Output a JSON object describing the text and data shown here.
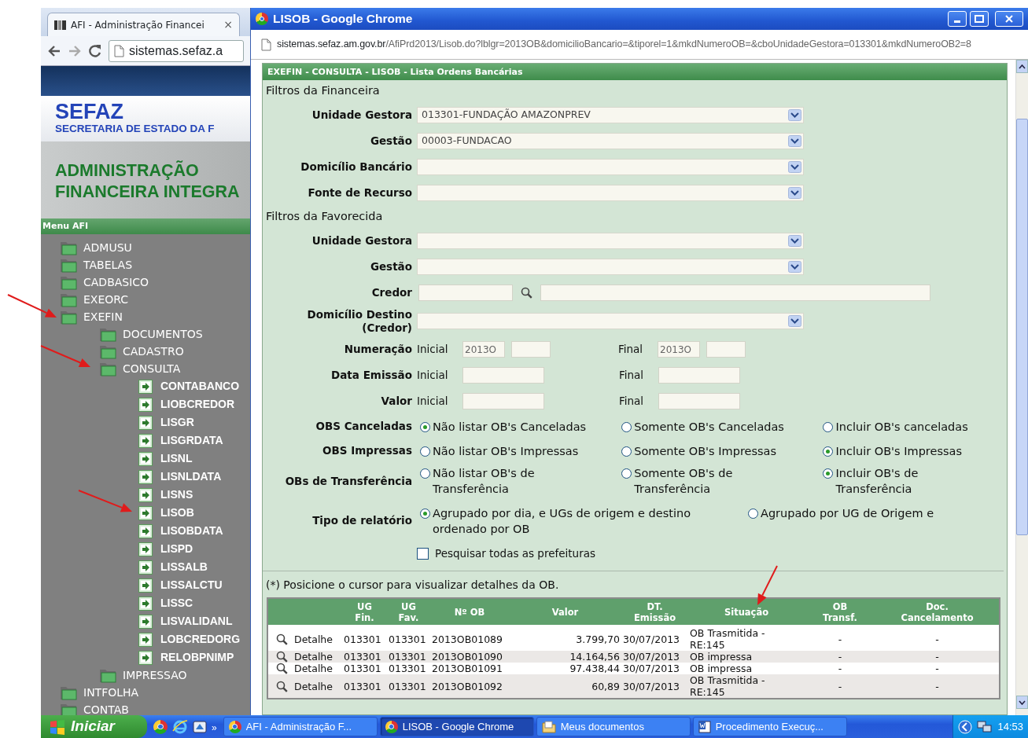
{
  "background_window": {
    "tab": {
      "title": "AFI - Administração Financei",
      "close": "×"
    },
    "address": "sistemas.sefaz.a",
    "header": {
      "brand": "SEFAZ",
      "subtitle": "SECRETARIA DE ESTADO DA F",
      "banner": [
        "ADMINISTRAÇÃO",
        "FINANCEIRA INTEGRA"
      ]
    },
    "menu": {
      "title": "Menu AFI",
      "items": [
        {
          "label": "ADMUSU",
          "kind": "folder"
        },
        {
          "label": "TABELAS",
          "kind": "folder"
        },
        {
          "label": "CADBASICO",
          "kind": "folder"
        },
        {
          "label": "EXEORC",
          "kind": "folder"
        },
        {
          "label": "EXEFIN",
          "kind": "folder",
          "children": [
            {
              "label": "DOCUMENTOS",
              "kind": "folder"
            },
            {
              "label": "CADASTRO",
              "kind": "folder"
            },
            {
              "label": "CONSULTA",
              "kind": "folder",
              "children": [
                {
                  "label": "CONTABANCO",
                  "kind": "page"
                },
                {
                  "label": "LIOBCREDOR",
                  "kind": "page"
                },
                {
                  "label": "LISGR",
                  "kind": "page"
                },
                {
                  "label": "LISGRDATA",
                  "kind": "page"
                },
                {
                  "label": "LISNL",
                  "kind": "page"
                },
                {
                  "label": "LISNLDATA",
                  "kind": "page"
                },
                {
                  "label": "LISNS",
                  "kind": "page"
                },
                {
                  "label": "LISOB",
                  "kind": "page"
                },
                {
                  "label": "LISOBDATA",
                  "kind": "page"
                },
                {
                  "label": "LISPD",
                  "kind": "page"
                },
                {
                  "label": "LISSALB",
                  "kind": "page"
                },
                {
                  "label": "LISSALCTU",
                  "kind": "page"
                },
                {
                  "label": "LISSC",
                  "kind": "page"
                },
                {
                  "label": "LISVALIDANL",
                  "kind": "page"
                },
                {
                  "label": "LOBCREDORG",
                  "kind": "page"
                },
                {
                  "label": "RELOBPNIMP",
                  "kind": "page"
                }
              ]
            },
            {
              "label": "IMPRESSAO",
              "kind": "folder"
            }
          ]
        },
        {
          "label": "INTFOLHA",
          "kind": "folder"
        },
        {
          "label": "CONTAB",
          "kind": "folder"
        }
      ]
    }
  },
  "popup_window": {
    "title": "LISOB - Google Chrome",
    "address": {
      "host": "sistemas.sefaz.am.gov.br",
      "path": "/AfiPrd2013/Lisob.do?lblgr=2013OB&domicilioBancario=&tiporel=1&mkdNumeroOB=&cboUnidadeGestora=013301&mkdNumeroOB2=8"
    },
    "panel_title": "EXEFIN - CONSULTA - LISOB - Lista Ordens Bancárias",
    "form": [
      {
        "kind": "section",
        "label": "Filtros da Financeira"
      },
      {
        "kind": "select",
        "label": "Unidade Gestora",
        "value": "013301-FUNDAÇÃO AMAZONPREV"
      },
      {
        "kind": "select",
        "label": "Gestão",
        "value": "00003-FUNDACAO"
      },
      {
        "kind": "select",
        "label": "Domicílio Bancário"
      },
      {
        "kind": "select",
        "label": "Fonte de Recurso"
      },
      {
        "kind": "section",
        "label": "Filtros da Favorecida"
      },
      {
        "kind": "select",
        "label": "Unidade Gestora"
      },
      {
        "kind": "select",
        "label": "Gestão"
      },
      {
        "kind": "lookup",
        "label": "Credor"
      },
      {
        "kind": "select",
        "label": "Domicílio Destino (Credor)"
      },
      {
        "kind": "range",
        "label": "Numeração",
        "from_label": "Inicial",
        "from_value": "2013O",
        "to_label": "Final",
        "to_value": "2013O"
      },
      {
        "kind": "range",
        "label": "Data Emissão",
        "from_label": "Inicial",
        "to_label": "Final"
      },
      {
        "kind": "range",
        "label": "Valor",
        "from_label": "Inicial",
        "to_label": "Final"
      },
      {
        "kind": "radio",
        "label": "OBS Canceladas",
        "options": [
          {
            "label": "Não listar OB's Canceladas",
            "selected": true
          },
          {
            "label": "Somente OB's Canceladas",
            "selected": false
          },
          {
            "label": "Incluir OB's canceladas",
            "selected": false
          }
        ]
      },
      {
        "kind": "radio",
        "label": "OBS Impressas",
        "options": [
          {
            "label": "Não listar OB's Impressas",
            "selected": false
          },
          {
            "label": "Somente OB's Impressas",
            "selected": false
          },
          {
            "label": "Incluir OB's Impressas",
            "selected": true
          }
        ]
      },
      {
        "kind": "radio",
        "label": "OBs de Transferência",
        "options": [
          {
            "label": "Não listar OB's de Transferência",
            "selected": false
          },
          {
            "label": "Somente OB's de Transferência",
            "selected": false
          },
          {
            "label": "Incluir OB's de Transferência",
            "selected": true
          }
        ]
      },
      {
        "kind": "radio",
        "label": "Tipo de relatório",
        "options": [
          {
            "label": "Agrupado por dia, e UGs de origem e destino ordenado por OB",
            "selected": true
          },
          {
            "label": "Agrupado por UG de Origem e",
            "selected": false
          }
        ]
      },
      {
        "kind": "checkbox",
        "label": "Pesquisar todas as prefeituras",
        "checked": false
      }
    ],
    "note": "(*) Posicione o cursor para visualizar detalhes da OB.",
    "table": {
      "columns": [
        "UG Fin.",
        "UG Fav.",
        "Nº OB",
        "Valor",
        "DT. Emissão",
        "Situação",
        "OB Transf.",
        "Doc. Cancelamento"
      ],
      "rows": [
        {
          "link": "Detalhe",
          "cells": [
            "013301",
            "013301",
            "2013OB01089",
            "3.799,70",
            "30/07/2013",
            "OB Trasmitida - RE:145",
            "-",
            "-"
          ]
        },
        {
          "link": "Detalhe",
          "cells": [
            "013301",
            "013301",
            "2013OB01090",
            "14.164,56",
            "30/07/2013",
            "OB impressa",
            "-",
            "-"
          ]
        },
        {
          "link": "Detalhe",
          "cells": [
            "013301",
            "013301",
            "2013OB01091",
            "97.438,44",
            "30/07/2013",
            "OB impressa",
            "-",
            "-"
          ]
        },
        {
          "link": "Detalhe",
          "cells": [
            "013301",
            "013301",
            "2013OB01092",
            "60,89",
            "30/07/2013",
            "OB Trasmitida - RE:145",
            "-",
            "-"
          ]
        }
      ]
    }
  },
  "taskbar": {
    "start": "Iniciar",
    "more": "»",
    "tasks": [
      {
        "label": "AFI - Administração F...",
        "selected": false
      },
      {
        "label": "LISOB - Google Chrome",
        "selected": true
      },
      {
        "label": "Meus documentos",
        "selected": false
      },
      {
        "label": "Procedimento Execuç...",
        "selected": false
      }
    ],
    "clock": "14:53"
  }
}
